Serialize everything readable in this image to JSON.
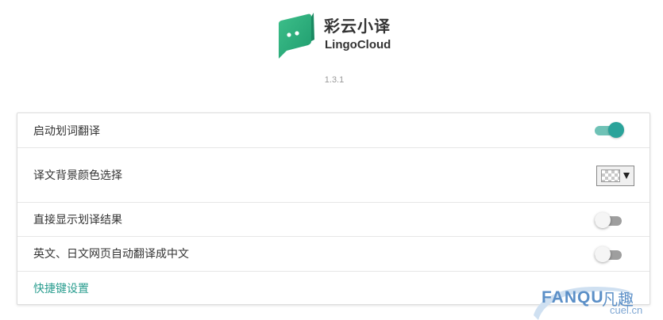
{
  "header": {
    "app_name_cn": "彩云小译",
    "app_name_en": "LingoCloud",
    "version": "1.3.1",
    "logo_icon": "chat-bubble-logo-icon",
    "brand_color": "#2aa39a"
  },
  "settings": {
    "rows": [
      {
        "label": "启动划词翻译",
        "control": "toggle",
        "checked": true
      },
      {
        "label": "译文背景颜色选择",
        "control": "color-select",
        "value": "transparent"
      },
      {
        "label": "直接显示划译结果",
        "control": "toggle",
        "checked": false
      },
      {
        "label": "英文、日文网页自动翻译成中文",
        "control": "toggle",
        "checked": false
      }
    ],
    "shortcut_link": "快捷键设置"
  },
  "watermark": {
    "text": "FANQU",
    "text_cn": "凡趣",
    "domain": "cuel.cn"
  }
}
